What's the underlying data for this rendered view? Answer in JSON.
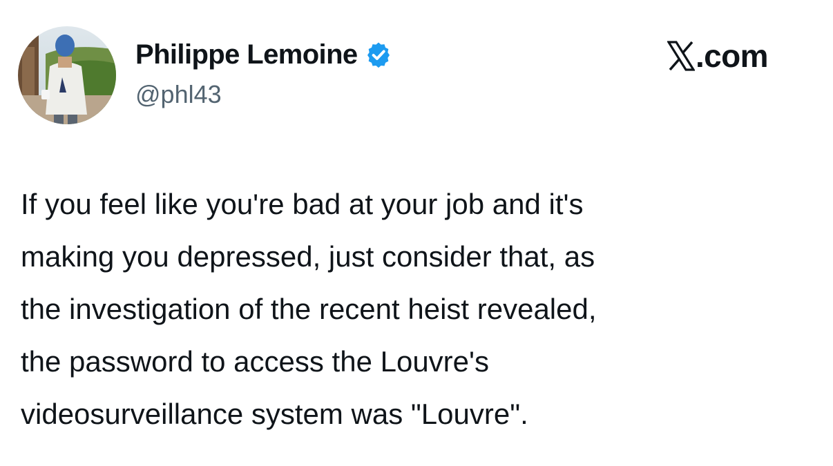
{
  "header": {
    "display_name": "Philippe Lemoine",
    "handle": "@phl43",
    "verified": true,
    "verified_icon": "verified-badge-icon",
    "brand_logo_icon": "x-logo-icon",
    "brand_suffix": ".com"
  },
  "tweet": {
    "lines": [
      "If you feel like you're bad at your job and it's",
      "making you depressed, just consider that, as",
      "the investigation of the recent heist revealed,",
      "the password to access the Louvre's",
      "videosurveillance system was \"Louvre\"."
    ]
  },
  "colors": {
    "text": "#0f1419",
    "secondary_text": "#536471",
    "verified_blue": "#1d9bf0",
    "background": "#ffffff"
  }
}
